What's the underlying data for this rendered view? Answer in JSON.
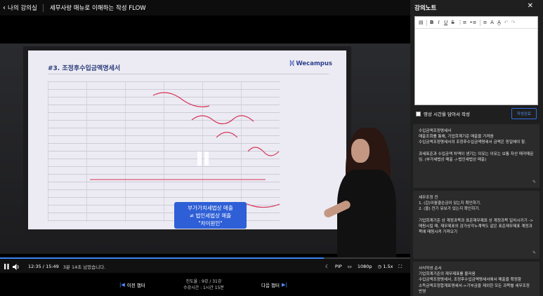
{
  "header": {
    "back_label": "나의 강의실",
    "course_title": "세무사랑 매뉴로 이해하는 작성 FLOW"
  },
  "slide": {
    "title": "#3. 조정후수입금액명세서",
    "brand": "Wecampus",
    "callout_lines": [
      "부가가치세법상 매출",
      "≠ 법인세법상 매출",
      "\"차이원인\""
    ]
  },
  "player": {
    "progress_fraction": 0.79,
    "current_time": "12:35",
    "total_time": "15:49",
    "remaining_text": "3분 14초 남았습니다.",
    "pip_label": "PIP",
    "quality_label": "1080p",
    "speed_label": "1.5x"
  },
  "nav": {
    "prev_label": "이전 챕터",
    "next_label": "다음 챕터",
    "progress_text": "진도율 : 9강 / 31강",
    "duration_text": "수강시간 : 1시간 15분"
  },
  "panel": {
    "title": "강의노트",
    "toolbar": [
      "B",
      "I",
      "U",
      "S"
    ],
    "save_time_label": "영상 시간을 담아서 작성",
    "save_button": "작성완료",
    "notes": [
      {
        "text": "수입금액조정명세서\n매출조회를 통해, 기업회계기준 매출을 가져옴\n수입금액조정명세서의 조정후수입금액명세서 금액은 동일해야 함.\n\n과세표준과 수입금액 차액이 생기는 이유는 이유는 보통 자산 매각때문임. (부가세법상 매출 -/-법인세법상 매출)"
      },
      {
        "text": "세무조정 전\n1. (갑)이월결손금이 있는지 확인하기.\n2. (을) 전기 유보가 있는지 확인하기.\n\n기업회계기준 상 계정과목과 표준재무제표 상 계정과목 일치시키기 -> 매핑시킬 때, 재무제표의 감가상각누계액도 같은 표준재무제표 계정과목에 매핑시켜 가져오기"
      },
      {
        "text": "서식작성 순서\n기업회계기준의 재무제표를 불러옴\n수입금액조정명세서, 조정후수입금액명세서에서 매출을 확정함\n소득금액조정합계표명세서->기부금을 제외한 모든 과목별 세무조정 반영"
      }
    ]
  }
}
